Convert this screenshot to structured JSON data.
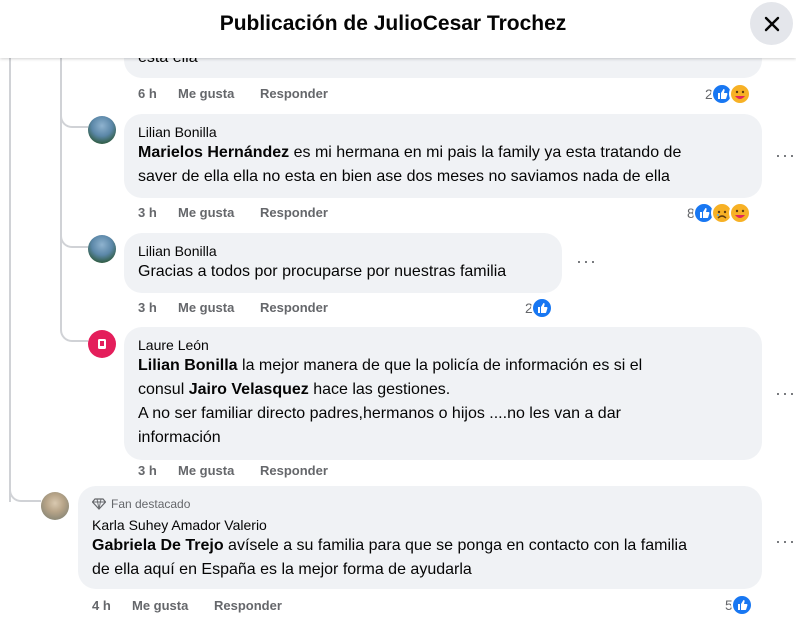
{
  "header": {
    "title": "Publicación de JulioCesar Trochez"
  },
  "comments": [
    {
      "text_end": "esta ella",
      "time": "6 h",
      "like": "Me gusta",
      "reply": "Responder",
      "reactions": "2"
    },
    {
      "author": "Lilian Bonilla",
      "mention": "Marielos Hernández",
      "text_line1": " es mi hermana en mi pais la family ya esta tratando de",
      "text_line2": "saver de ella ella no esta en bien ase dos meses no saviamos nada de ella",
      "time": "3 h",
      "like": "Me gusta",
      "reply": "Responder",
      "reactions": "8"
    },
    {
      "author": "Lilian Bonilla",
      "text": "Gracias a todos por procuparse por nuestras familia",
      "time": "3 h",
      "like": "Me gusta",
      "reply": "Responder",
      "reactions": "2"
    },
    {
      "author": "Laure León",
      "mention1": "Lilian Bonilla",
      "text1": " la mejor manera de que la policía de información es si el",
      "text2a": "consul ",
      "mention2": "Jairo Velasquez",
      "text2b": " hace las gestiones.",
      "text3": "A no ser familiar directo padres,hermanos o hijos ....no les van a dar",
      "text4": "información",
      "time": "3 h",
      "like": "Me gusta",
      "reply": "Responder"
    },
    {
      "badge": "Fan destacado",
      "author": "Karla Suhey Amador Valerio",
      "mention": "Gabriela De Trejo",
      "text_line1": " avísele a su familia para que se ponga en contacto con la familia",
      "text_line2": "de ella aquí en España es la mejor forma de ayudarla",
      "time": "4 h",
      "like": "Me gusta",
      "reply": "Responder",
      "reactions": "5"
    }
  ],
  "more_label": "···",
  "colors": {
    "like_blue": "#1877f2",
    "secondary_text": "#65676b",
    "bubble_bg": "#f0f2f5"
  }
}
